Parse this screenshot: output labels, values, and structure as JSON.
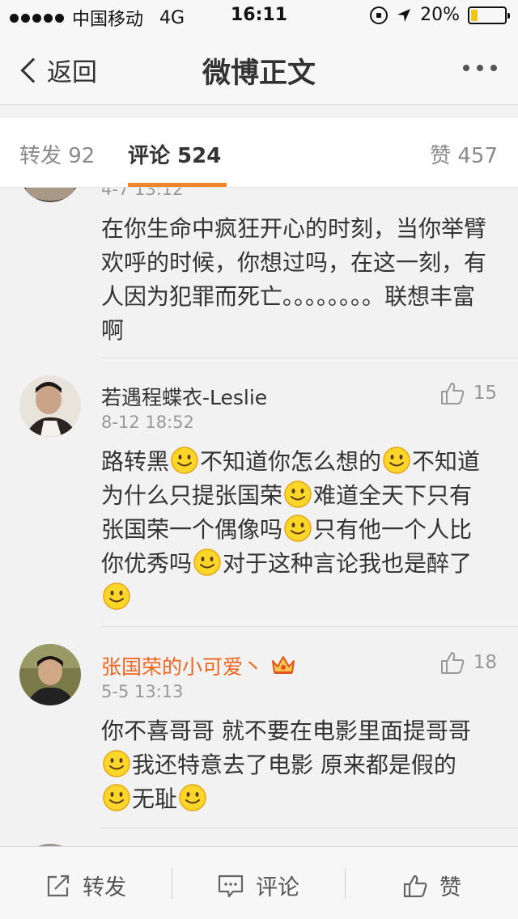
{
  "status_bar": {
    "carrier": "中国移动",
    "network": "4G",
    "time": "16:11",
    "battery": "20%",
    "battery_level": 0.2,
    "battery_color": "#f0c419"
  },
  "nav": {
    "back_label": "返回",
    "title": "微博正文",
    "more_icon": "more-dots-icon"
  },
  "tabs": {
    "repost": "转发 92",
    "comment": "评论 524",
    "like": "赞 457",
    "active_color": "#f2842a"
  },
  "comments": [
    {
      "time": "4-7 13:12",
      "text_parts": [
        "在你生命中疯狂开心的时刻，当你举臂欢呼的时候，你想过吗，在这一刻，有人因为犯罪而死亡。。。。。。。。联想丰富啊"
      ]
    },
    {
      "name": "若遇程蝶衣-Leslie",
      "time": "8-12 18:52",
      "likes": "15",
      "text_parts": [
        "路转黑",
        "不知道你怎么想的",
        "不知道为什么只提张国荣",
        "难道全天下只有张国荣一个偶像吗",
        "只有他一个人比你优秀吗",
        "对于这种言论我也是醉了",
        ""
      ]
    },
    {
      "name": "张国荣的小可爱丶",
      "name_color": "#f0641e",
      "badge_icon": "crown-icon",
      "time": "5-5 13:13",
      "likes": "18",
      "text_parts": [
        "你不喜哥哥  就不要在电影里面提哥哥",
        "我还特意去了电影 原来都是假的  ",
        "无耻",
        ""
      ]
    }
  ],
  "toolbar": {
    "repost": "转发",
    "comment": "评论",
    "like": "赞"
  }
}
